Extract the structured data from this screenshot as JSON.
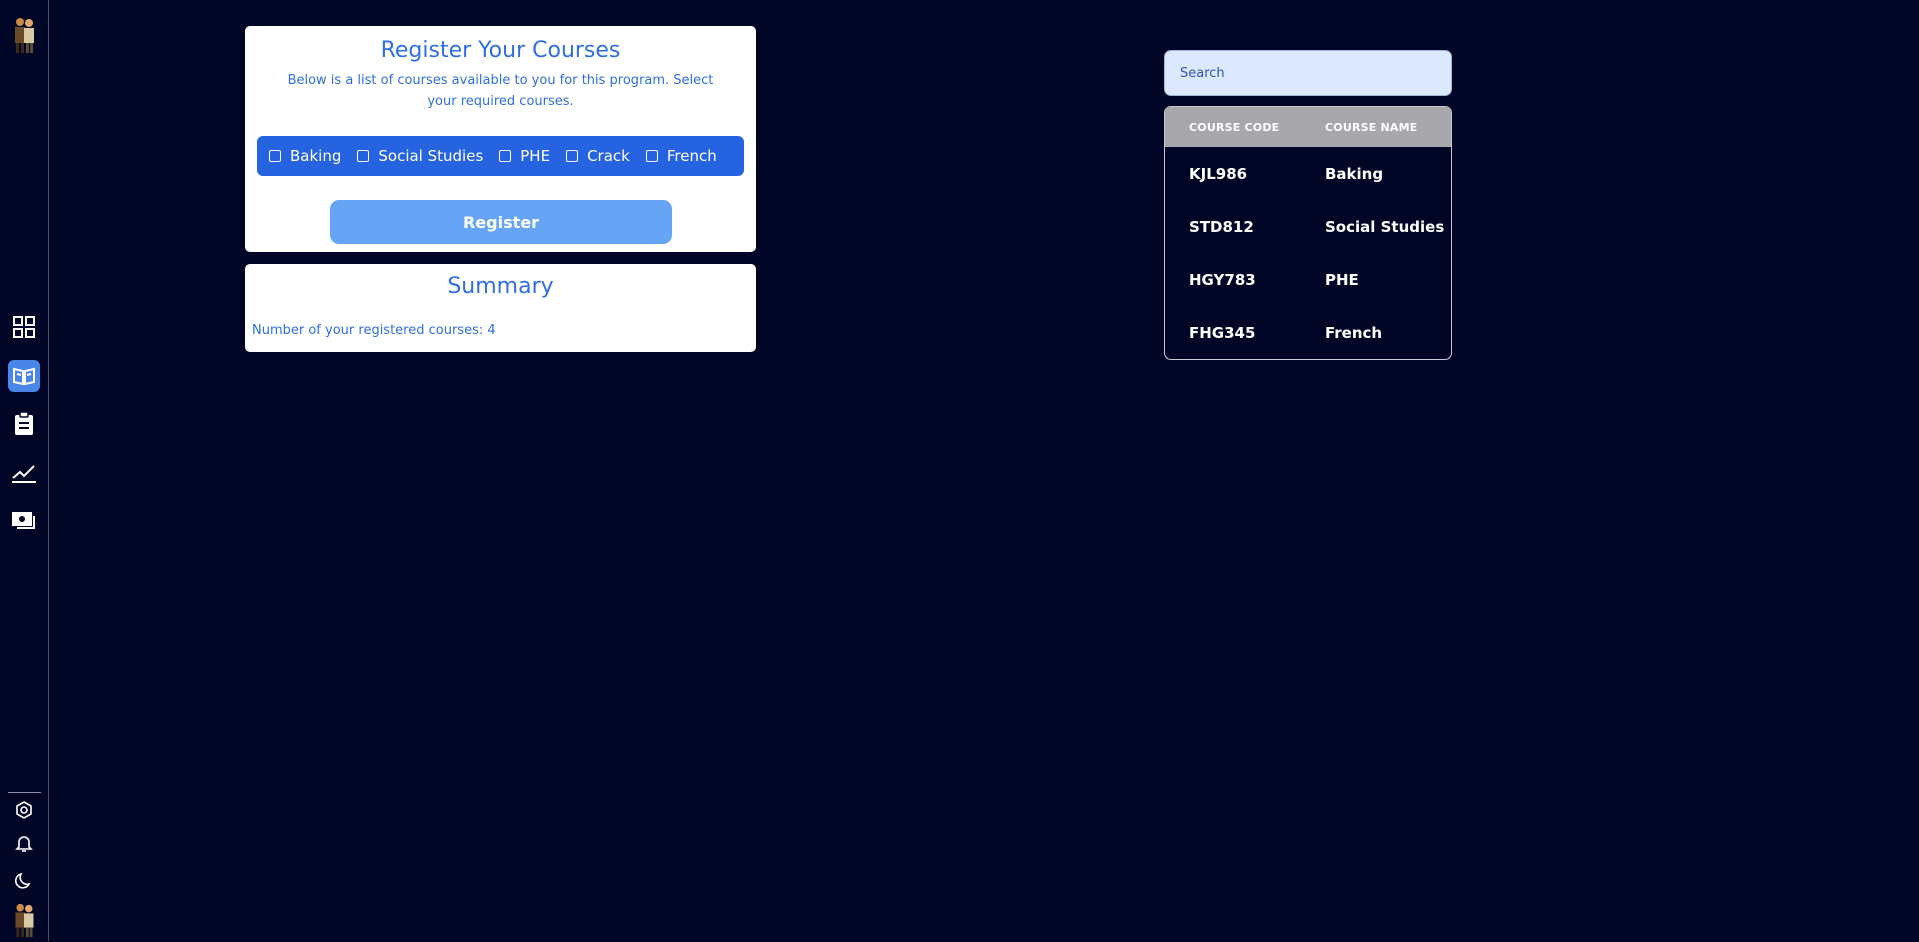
{
  "register": {
    "title": "Register Your Courses",
    "subtitle": "Below is a list of courses available to you for this program. Select your required courses.",
    "courses": [
      "Baking",
      "Social Studies",
      "PHE",
      "Crack",
      "French"
    ],
    "button_label": "Register"
  },
  "summary": {
    "title": "Summary",
    "text": "Number of your registered courses: 4"
  },
  "search": {
    "placeholder": "Search"
  },
  "table": {
    "headers": [
      "COURSE CODE",
      "COURSE NAME"
    ],
    "rows": [
      {
        "code": "KJL986",
        "name": "Baking"
      },
      {
        "code": "STD812",
        "name": "Social Studies"
      },
      {
        "code": "HGY783",
        "name": "PHE"
      },
      {
        "code": "FHG345",
        "name": "French"
      }
    ]
  },
  "colors": {
    "background": "#020626",
    "accent": "#2563e0",
    "button": "#66a5f5",
    "table_header": "#a8a8ac"
  },
  "sidebar": {
    "icons": [
      "dashboard-icon",
      "courses-icon",
      "clipboard-icon",
      "chart-icon",
      "payments-icon",
      "settings-icon",
      "bell-icon",
      "moon-icon"
    ],
    "active": "courses-icon"
  }
}
